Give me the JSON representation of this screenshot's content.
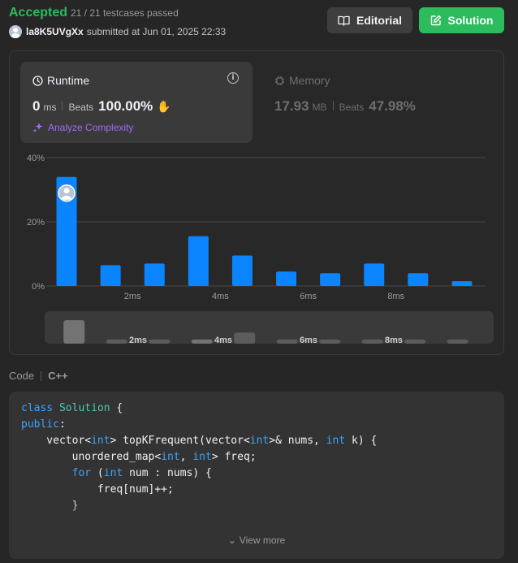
{
  "header": {
    "status": "Accepted",
    "testcases": "21 / 21 testcases passed",
    "username": "la8K5UVgXx",
    "submitted_text": "submitted at Jun 01, 2025 22:33",
    "editorial_label": "Editorial",
    "solution_label": "Solution"
  },
  "runtime": {
    "title": "Runtime",
    "value": "0",
    "unit": "ms",
    "beats_label": "Beats",
    "beats_value": "100.00%",
    "analyze_label": "Analyze Complexity"
  },
  "memory": {
    "title": "Memory",
    "value": "17.93",
    "unit": "MB",
    "beats_label": "Beats",
    "beats_value": "47.98%"
  },
  "chart_data": {
    "type": "bar",
    "y_ticks": [
      "40%",
      "20%",
      "0%"
    ],
    "ylim": [
      0,
      40
    ],
    "x_ticks": [
      "2ms",
      "4ms",
      "6ms",
      "8ms"
    ],
    "values": [
      34,
      6.5,
      7,
      15.5,
      9.5,
      4.5,
      4,
      7,
      4,
      1.5
    ],
    "highlight_index": 0,
    "bar_color": "#0a84ff",
    "navigator_values": [
      8.5,
      1.5,
      1.5,
      1.5,
      4,
      1.5,
      1.5,
      1.5,
      1.5,
      1.5
    ],
    "navigator_color": "#5c5c5c",
    "navigator_highlight_color": "#737373"
  },
  "code": {
    "label": "Code",
    "language": "C++",
    "view_more": "View more"
  },
  "colors": {
    "accent_green": "#2cbb5d",
    "purple": "#a26bf0",
    "blue": "#0a84ff"
  }
}
